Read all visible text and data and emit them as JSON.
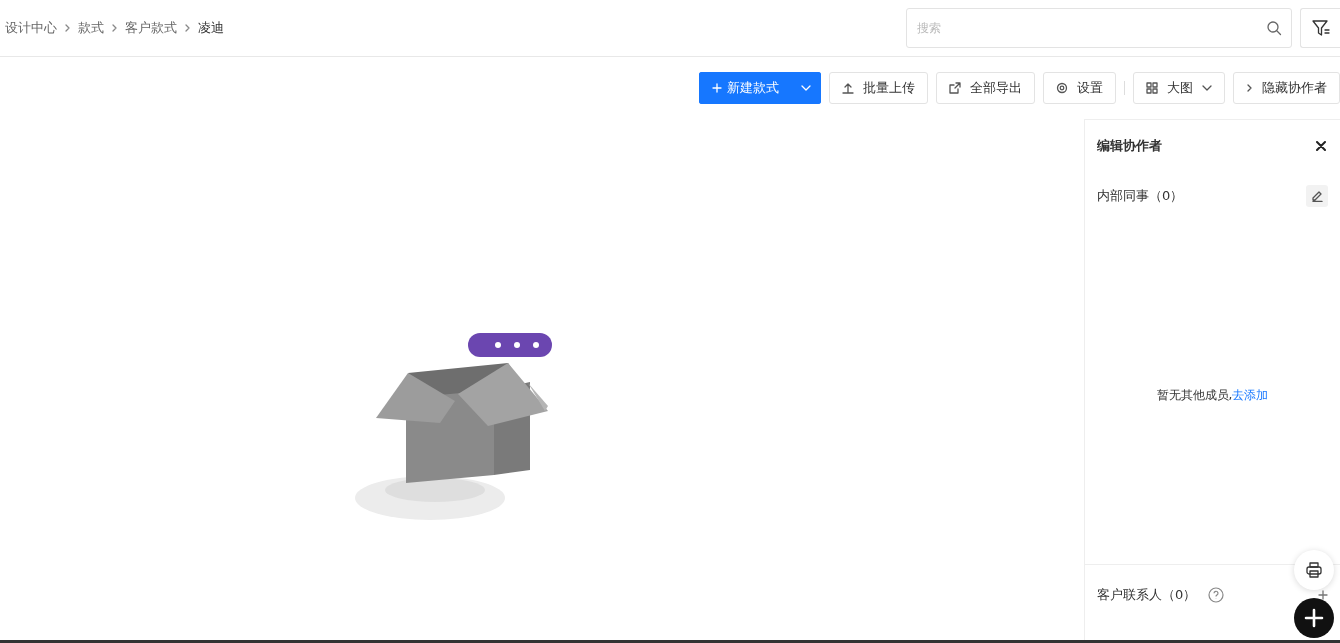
{
  "breadcrumb": [
    {
      "label": "设计中心",
      "current": false
    },
    {
      "label": "款式",
      "current": false
    },
    {
      "label": "客户款式",
      "current": false
    },
    {
      "label": "凌迪",
      "current": true
    }
  ],
  "search": {
    "placeholder": "搜索"
  },
  "toolbar": [
    {
      "kind": "primary",
      "label": "新建款式"
    },
    {
      "kind": "default",
      "label": "批量上传"
    },
    {
      "kind": "default",
      "label": "全部导出"
    },
    {
      "kind": "default",
      "label": "设置"
    },
    {
      "kind": "divider"
    },
    {
      "kind": "dropdown",
      "label": "大图"
    },
    {
      "kind": "default",
      "label": "隐藏协作者"
    }
  ],
  "panel": {
    "title": "编辑协作者",
    "internal": {
      "label": "内部同事（0）"
    },
    "empty_text": "暂无其他成员,",
    "empty_link": "去添加",
    "contacts": {
      "label": "客户联系人（0）"
    }
  }
}
